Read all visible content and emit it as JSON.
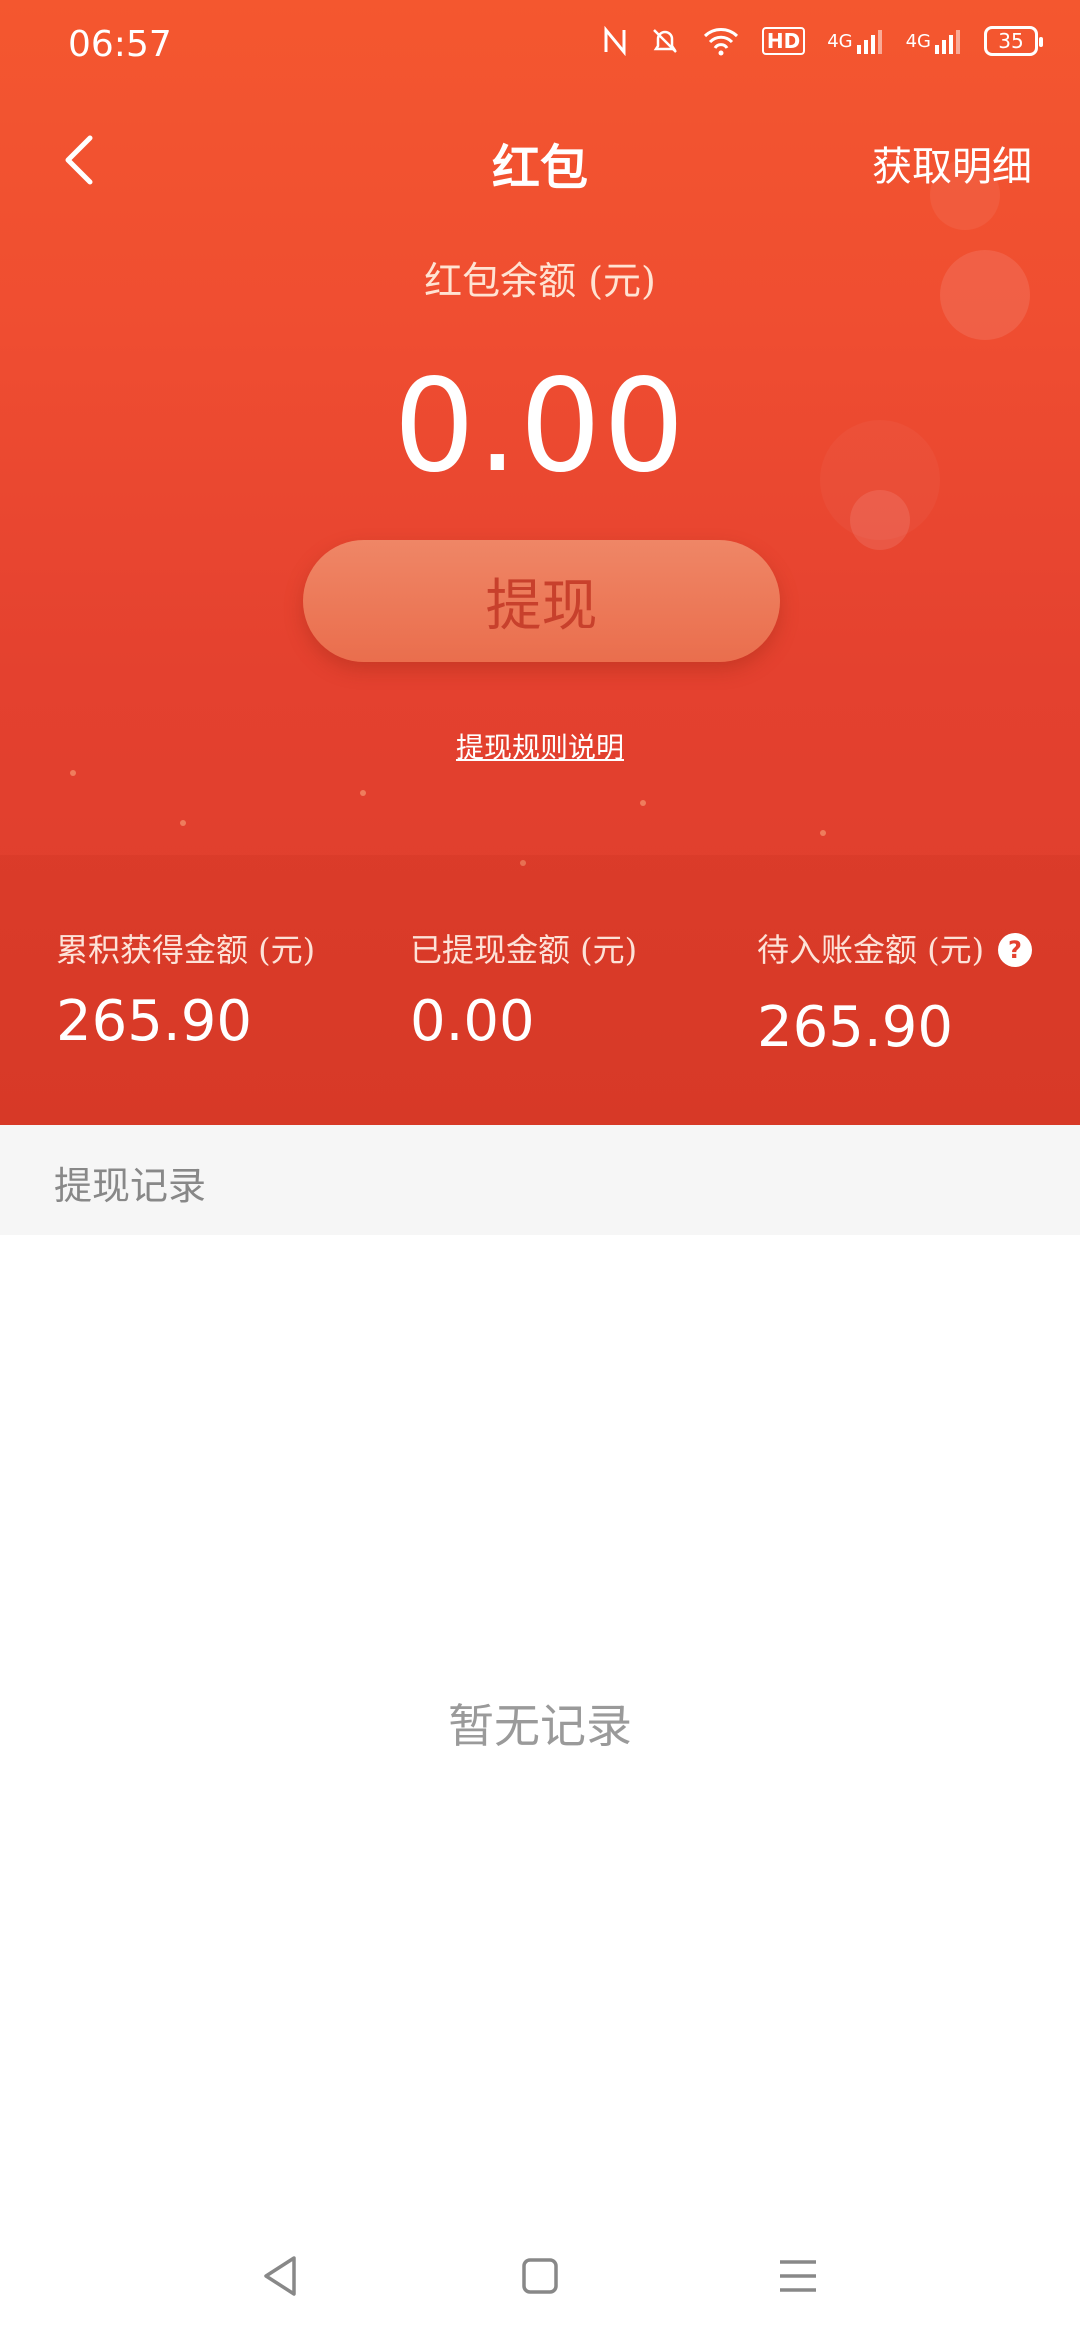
{
  "status_bar": {
    "time": "06:57",
    "hd_label": "HD",
    "net1": "4G",
    "net2": "4G",
    "battery": "35"
  },
  "header": {
    "title": "红包",
    "details_link": "获取明细"
  },
  "balance": {
    "label": "红包余额 (元)",
    "value": "0.00"
  },
  "withdraw_button": "提现",
  "rules_link": "提现规则说明",
  "stats": [
    {
      "label": "累积获得金额 (元)",
      "value": "265.90"
    },
    {
      "label": "已提现金额 (元)",
      "value": "0.00"
    },
    {
      "label": "待入账金额 (元)",
      "value": "265.90"
    }
  ],
  "help_icon": "?",
  "records": {
    "title": "提现记录",
    "empty": "暂无记录"
  },
  "colors": {
    "primary": "#e4412f",
    "button": "#ea6e4d",
    "button_text": "#c8402c",
    "muted": "#9a9a9a"
  }
}
